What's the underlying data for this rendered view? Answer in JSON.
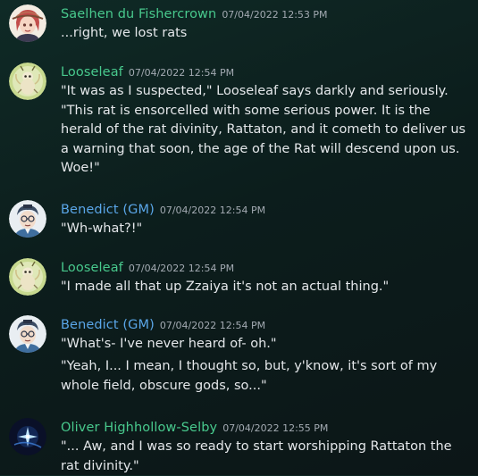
{
  "colors": {
    "green_author": "#48c98d",
    "blue_author": "#5aa6e8",
    "text": "#e4e7ea",
    "timestamp": "#a3aab2"
  },
  "messages": [
    {
      "author": "Saelhen du Fishercrown",
      "timestamp": "07/04/2022 12:53 PM",
      "avatar_icon": "saelhen-portrait-icon",
      "lines": [
        "...right, we lost rats"
      ]
    },
    {
      "author": "Looseleaf",
      "timestamp": "07/04/2022 12:54 PM",
      "avatar_icon": "looseleaf-bug-icon",
      "lines": [
        "\"It was as I suspected,\" Looseleaf says darkly and seriously. \"This rat is ensorcelled with some serious power. It is the herald of the rat divinity, Rattaton, and it cometh to deliver us a warning that soon, the age of the Rat will descend upon us. Woe!\""
      ]
    },
    {
      "author": "Benedict (GM)",
      "timestamp": "07/04/2022 12:54 PM",
      "avatar_icon": "benedict-portrait-icon",
      "lines": [
        "\"Wh-what?!\""
      ]
    },
    {
      "author": "Looseleaf",
      "timestamp": "07/04/2022 12:54 PM",
      "avatar_icon": "looseleaf-bug-icon",
      "lines": [
        "\"I made all that up Zzaiya it's not an actual thing.\""
      ]
    },
    {
      "author": "Benedict (GM)",
      "timestamp": "07/04/2022 12:54 PM",
      "avatar_icon": "benedict-portrait-icon",
      "lines": [
        "\"What's- I've never heard of- oh.\"",
        "\"Yeah, I... I mean, I thought so, but, y'know, it's sort of my whole field, obscure gods, so...\""
      ]
    },
    {
      "author": "Oliver Highhollow-Selby",
      "timestamp": "07/04/2022 12:55 PM",
      "avatar_icon": "oliver-star-icon",
      "lines": [
        "\"... Aw, and I was so ready to start worshipping Rattaton the rat divinity.\""
      ]
    }
  ]
}
